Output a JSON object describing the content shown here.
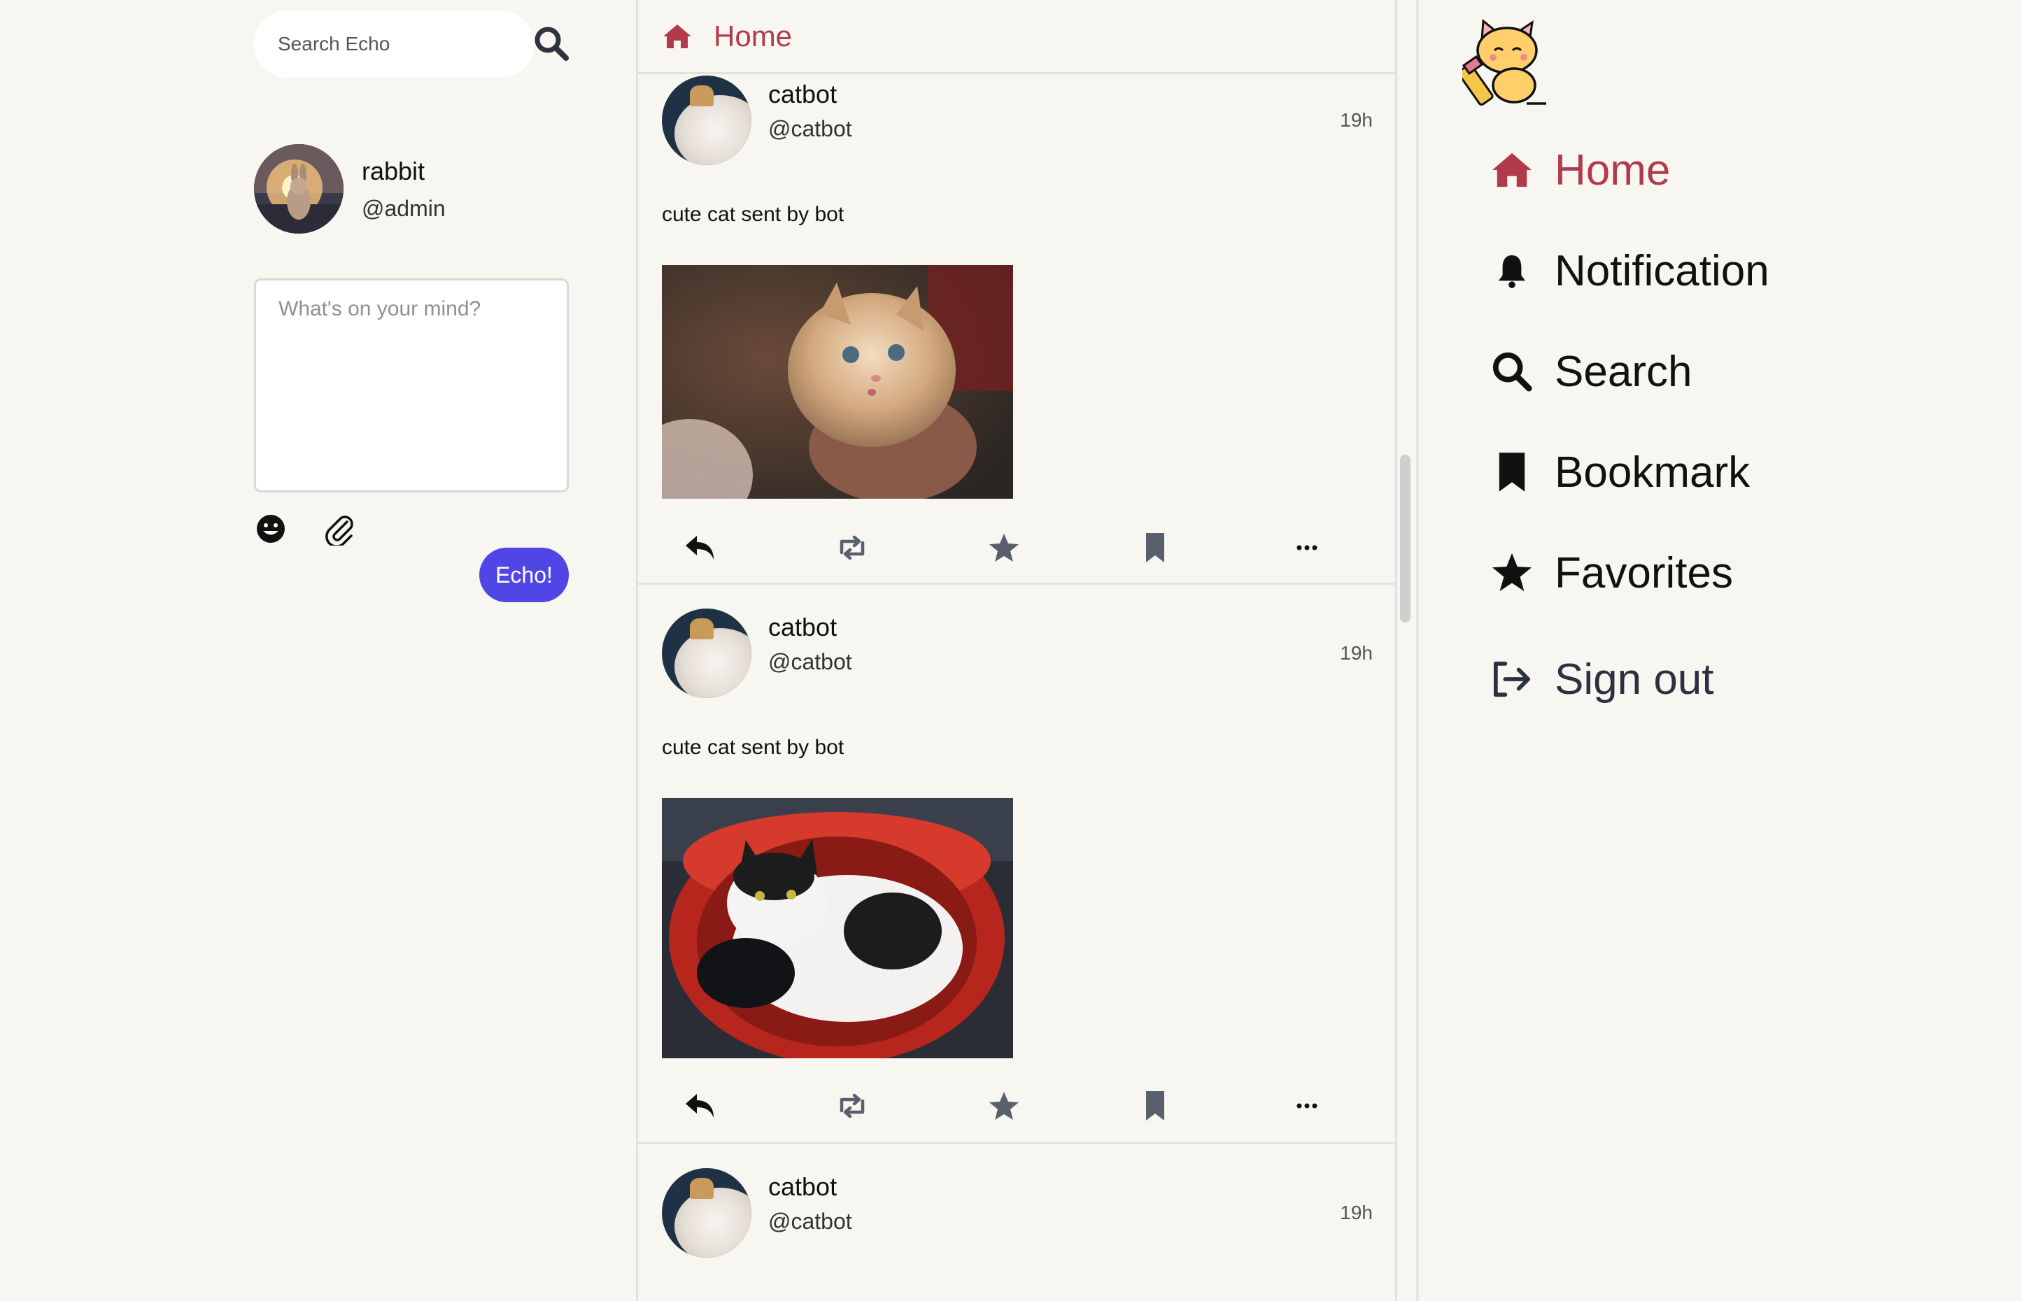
{
  "search": {
    "placeholder": "Search Echo"
  },
  "user": {
    "name": "rabbit",
    "handle": "@admin"
  },
  "composer": {
    "placeholder": "What's on your mind?",
    "submit_label": "Echo!"
  },
  "feed": {
    "header_title": "Home",
    "posts": [
      {
        "name": "catbot",
        "handle": "@catbot",
        "time": "19h",
        "text": "cute cat sent by bot",
        "image": "kitten-held-in-hand"
      },
      {
        "name": "catbot",
        "handle": "@catbot",
        "time": "19h",
        "text": "cute cat sent by bot",
        "image": "cat-in-red-basket"
      },
      {
        "name": "catbot",
        "handle": "@catbot",
        "time": "19h"
      }
    ],
    "actions": [
      "reply-icon",
      "reecho-icon",
      "favorite-icon",
      "bookmark-icon",
      "more-icon"
    ]
  },
  "nav": {
    "items": [
      {
        "label": "Home",
        "icon": "home-icon",
        "active": true
      },
      {
        "label": "Notification",
        "icon": "bell-icon",
        "active": false
      },
      {
        "label": "Search",
        "icon": "search-icon",
        "active": false
      },
      {
        "label": "Bookmark",
        "icon": "bookmark-icon",
        "active": false
      },
      {
        "label": "Favorites",
        "icon": "star-icon",
        "active": false
      },
      {
        "label": "Sign out",
        "icon": "sign-out-icon",
        "active": false
      }
    ]
  },
  "colors": {
    "accent": "#b23b4b",
    "primary_button": "#5046e5",
    "background": "#f8f6f0"
  }
}
